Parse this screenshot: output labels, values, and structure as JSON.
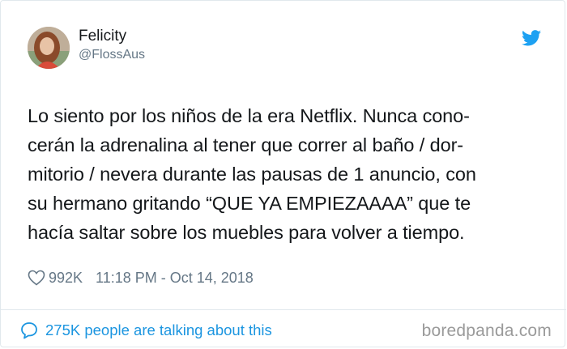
{
  "tweet": {
    "author_name": "Felicity",
    "author_handle": "@FlossAus",
    "text_lines": [
      "Lo siento por los niños de la era Netflix. Nunca cono-",
      "cerán la adrenalina al tener que correr al baño / dor-",
      "mitorio / nevera durante las pausas de 1 anuncio, con",
      "su hermano gritando “QUE YA EMPIEZAAAA” que te",
      "hacía saltar sobre los muebles para volver a tiempo."
    ],
    "likes": "992K",
    "timestamp": "11:18 PM - Oct 14, 2018",
    "conversation_text": "275K people are talking about this"
  },
  "icons": {
    "brand": "twitter-bird-icon",
    "like": "heart-icon",
    "conversation": "speech-bubble-icon"
  },
  "watermark": "boredpanda.com",
  "colors": {
    "text": "#14171a",
    "secondary": "#657786",
    "accent": "#1da1f2",
    "link": "#1b95e0",
    "border": "#e1e8ed",
    "watermark": "#9a9a9a"
  }
}
